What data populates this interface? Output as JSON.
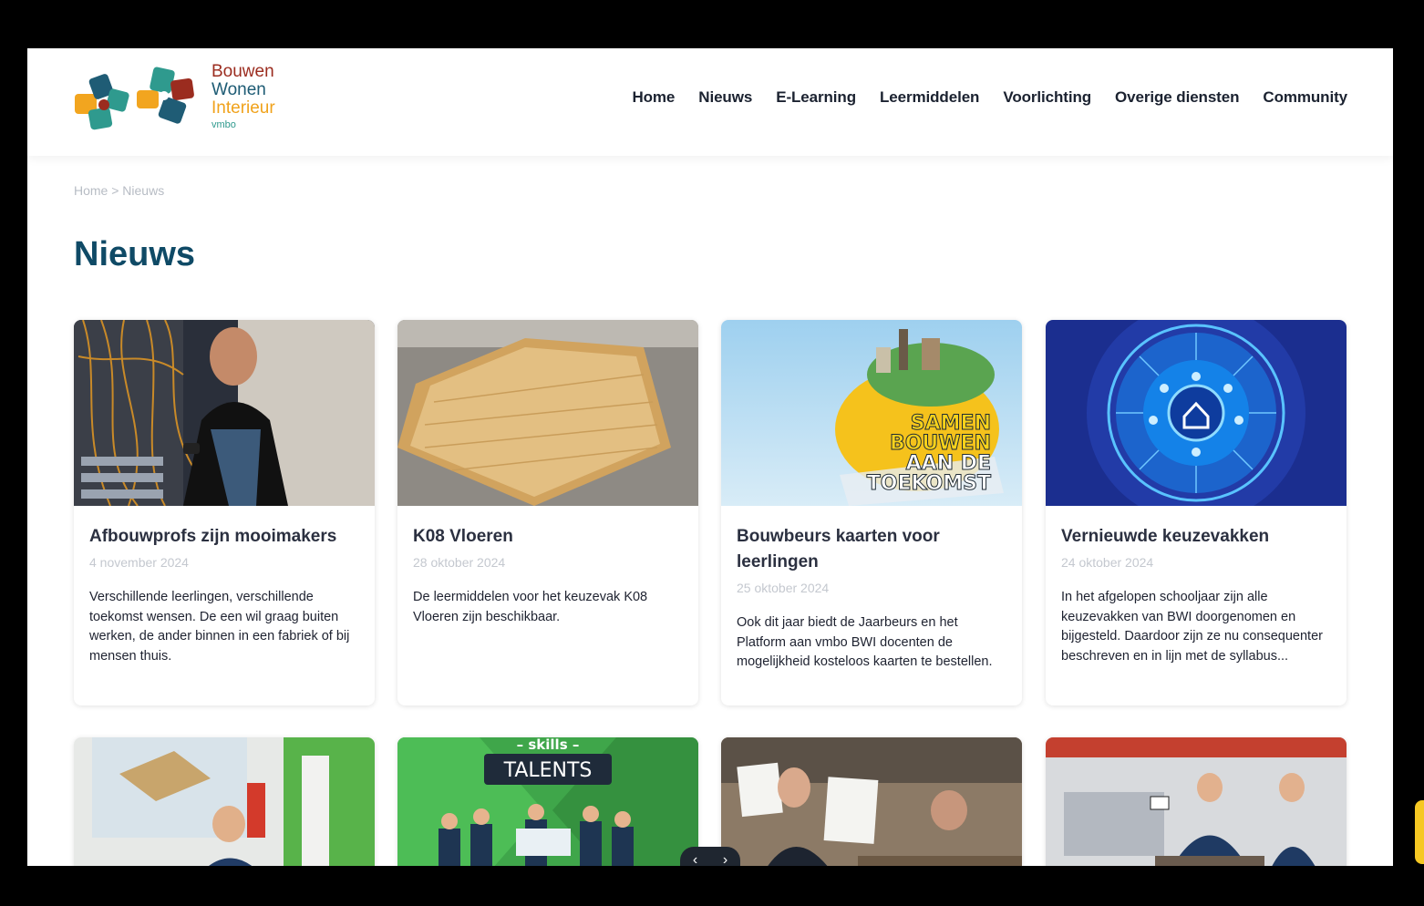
{
  "logo": {
    "line1": "Bouwen",
    "line2": "Wonen",
    "line3": "Interieur",
    "line4": "vmbo"
  },
  "nav": [
    "Home",
    "Nieuws",
    "E-Learning",
    "Leermiddelen",
    "Voorlichting",
    "Overige diensten",
    "Community"
  ],
  "breadcrumb": "Home > Nieuws",
  "page_title": "Nieuws",
  "cards": [
    {
      "title": "Afbouwprofs zijn mooimakers",
      "date": "4 november 2024",
      "excerpt": "Verschillende leerlingen, verschillende toekomst wensen. De een wil graag buiten werken, de ander binnen in een fabriek of bij mensen thuis."
    },
    {
      "title": "K08 Vloeren",
      "date": "28 oktober 2024",
      "excerpt": "De leermiddelen voor het keuzevak K08 Vloeren zijn beschikbaar."
    },
    {
      "title": "Bouwbeurs kaarten voor leerlingen",
      "date": "25 oktober 2024",
      "excerpt": "Ook dit jaar biedt de Jaarbeurs en het Platform aan vmbo BWI docenten de mogelijkheid kosteloos kaarten te bestellen.",
      "image_text": [
        "SAMEN",
        "BOUWEN",
        "AAN DE",
        "TOEKOMST"
      ]
    },
    {
      "title": "Vernieuwde keuzevakken",
      "date": "24 oktober 2024",
      "excerpt": "In het afgelopen schooljaar zijn alle keuzevakken van BWI doorgenomen en bijgesteld. Daardoor zijn ze nu consequenter beschreven en in lijn met de syllabus..."
    }
  ],
  "row2_image_text": {
    "skills": "– skills –",
    "talents": "TALENTS"
  },
  "carousel": {
    "prev": "‹",
    "next": "›"
  },
  "colors": {
    "title": "#0f4a66",
    "logo_red": "#9b2c1f",
    "logo_blue": "#1d5b74",
    "logo_orange": "#f0a21b",
    "logo_teal": "#2f9a8e"
  }
}
